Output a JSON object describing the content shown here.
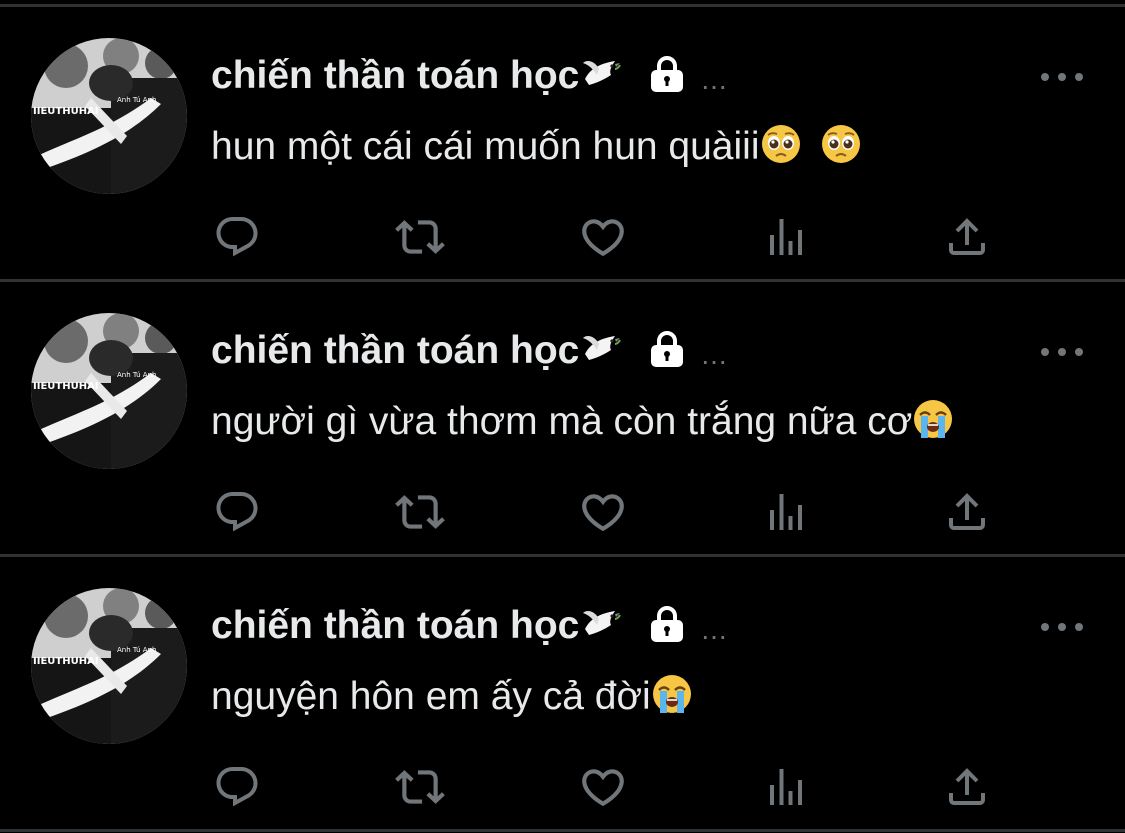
{
  "colors": {
    "background": "#000000",
    "text": "#e7e9ea",
    "secondary": "#71767b",
    "divider": "#2f3336"
  },
  "tweets": [
    {
      "display_name": "chiến thần toán học",
      "name_badges": [
        "dove-emoji",
        "lock-icon"
      ],
      "ellipsis": "...",
      "text": "hun một cái cái muốn hun quàiii",
      "trailing_emojis": [
        "pleading-face-emoji",
        "pleading-face-emoji"
      ]
    },
    {
      "display_name": "chiến thần toán học",
      "name_badges": [
        "dove-emoji",
        "lock-icon"
      ],
      "ellipsis": "...",
      "text": "người gì vừa thơm mà còn trắng nữa cơ",
      "trailing_emojis": [
        "loudly-crying-face-emoji"
      ]
    },
    {
      "display_name": "chiến thần toán học",
      "name_badges": [
        "dove-emoji",
        "lock-icon"
      ],
      "ellipsis": "...",
      "text": "nguyện hôn em ấy cả đời",
      "trailing_emojis": [
        "loudly-crying-face-emoji"
      ]
    }
  ],
  "action_icons": [
    "reply-icon",
    "retweet-icon",
    "like-icon",
    "views-icon",
    "share-icon"
  ],
  "avatar": {
    "shirt_text_left": "IIEUTHUHAI",
    "shirt_text_right": "Anh Tú Anh"
  }
}
